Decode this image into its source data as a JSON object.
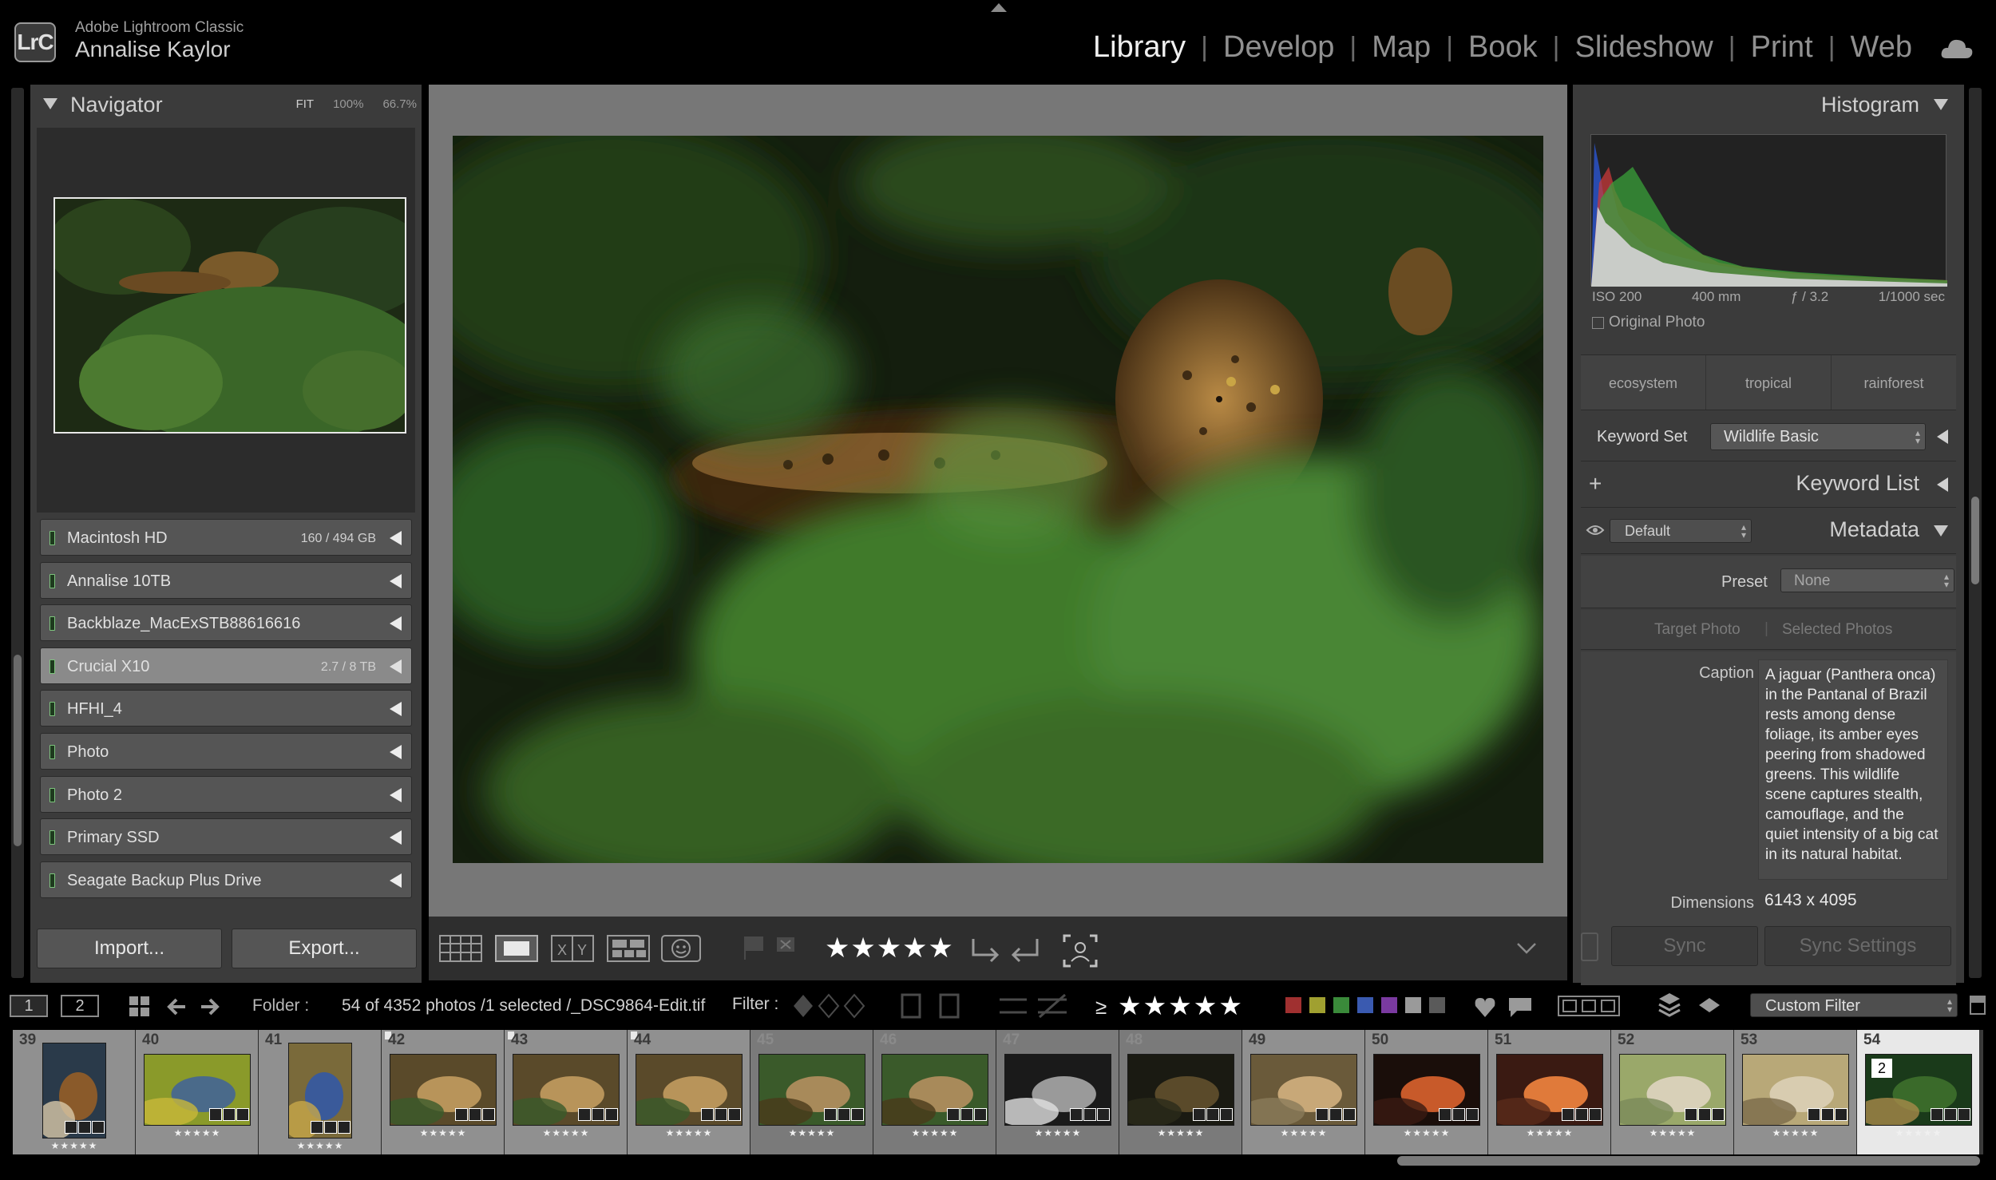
{
  "app": {
    "logo": "LrC",
    "name": "Adobe Lightroom Classic",
    "user": "Annalise Kaylor"
  },
  "modules": [
    {
      "label": "Library",
      "active": true
    },
    {
      "label": "Develop",
      "active": false
    },
    {
      "label": "Map",
      "active": false
    },
    {
      "label": "Book",
      "active": false
    },
    {
      "label": "Slideshow",
      "active": false
    },
    {
      "label": "Print",
      "active": false
    },
    {
      "label": "Web",
      "active": false
    }
  ],
  "module_separator": "|",
  "navigator": {
    "title": "Navigator",
    "zoom_fit": "FIT",
    "zoom_100": "100%",
    "zoom_custom": "66.7%"
  },
  "drives": [
    {
      "name": "Macintosh HD",
      "size": "160 / 494 GB",
      "selected": false
    },
    {
      "name": "Annalise 10TB",
      "size": "",
      "selected": false
    },
    {
      "name": "Backblaze_MacExSTB88616616",
      "size": "",
      "selected": false
    },
    {
      "name": "Crucial X10",
      "size": "2.7 / 8 TB",
      "selected": true
    },
    {
      "name": "HFHI_4",
      "size": "",
      "selected": false
    },
    {
      "name": "Photo",
      "size": "",
      "selected": false
    },
    {
      "name": "Photo 2",
      "size": "",
      "selected": false
    },
    {
      "name": "Primary SSD",
      "size": "",
      "selected": false
    },
    {
      "name": "Seagate Backup Plus Drive",
      "size": "",
      "selected": false
    }
  ],
  "buttons": {
    "import": "Import...",
    "export": "Export...",
    "sync": "Sync",
    "sync_settings": "Sync Settings"
  },
  "toolbar": {
    "stars": "★★★★★"
  },
  "histogram": {
    "title": "Histogram",
    "iso": "ISO 200",
    "focal": "400 mm",
    "aperture": "ƒ / 3.2",
    "shutter": "1/1000 sec",
    "original_photo": "Original Photo"
  },
  "keywords": {
    "suggestions": [
      "ecosystem",
      "tropical",
      "rainforest"
    ],
    "set_label": "Keyword Set",
    "set_value": "Wildlife Basic",
    "list_title": "Keyword List",
    "add_symbol": "+"
  },
  "metadata": {
    "title": "Metadata",
    "view": "Default",
    "preset_label": "Preset",
    "preset_value": "None",
    "target_photo": "Target Photo",
    "target_sep": "|",
    "selected_photos": "Selected Photos",
    "caption_label": "Caption",
    "caption": "A jaguar (Panthera onca) in the Pantanal of Brazil rests among dense foliage, its amber eyes peering from shadowed greens. This wildlife scene captures stealth, camouflage, and the quiet intensity of a big cat in its natural habitat.",
    "dimensions_label": "Dimensions",
    "dimensions": "6143 x 4095"
  },
  "filmstrip_bar": {
    "screen1": "1",
    "screen2": "2",
    "folder_label": "Folder :",
    "folder_info": "54 of 4352 photos /1 selected /_DSC9864-Edit.tif",
    "filter_label": "Filter :",
    "gte": "≥",
    "stars": "★★★★★",
    "custom_filter": "Custom Filter",
    "color_labels": [
      "#a03030",
      "#a0a030",
      "#3a8a3a",
      "#3a5ab0",
      "#7a3aa0",
      "#9a9a9a",
      "#5a5a5a"
    ]
  },
  "filmstrip": [
    {
      "num": "39",
      "stars": "★★★★★",
      "flag": false,
      "dim": false,
      "theme": "hawk"
    },
    {
      "num": "40",
      "stars": "★★★★★",
      "flag": false,
      "dim": false,
      "theme": "parrot"
    },
    {
      "num": "41",
      "stars": "★★★★★",
      "flag": false,
      "dim": false,
      "theme": "macaw"
    },
    {
      "num": "42",
      "stars": "★★★★★",
      "flag": true,
      "dim": false,
      "theme": "jaguar"
    },
    {
      "num": "43",
      "stars": "★★★★★",
      "flag": true,
      "dim": false,
      "theme": "jaguar"
    },
    {
      "num": "44",
      "stars": "★★★★★",
      "flag": true,
      "dim": false,
      "theme": "jaguar"
    },
    {
      "num": "45",
      "stars": "★★★★★",
      "flag": false,
      "dim": true,
      "theme": "jaguar2"
    },
    {
      "num": "46",
      "stars": "★★★★★",
      "flag": false,
      "dim": true,
      "theme": "jaguar2"
    },
    {
      "num": "47",
      "stars": "★★★★★",
      "flag": false,
      "dim": true,
      "theme": "bw"
    },
    {
      "num": "48",
      "stars": "★★★★★",
      "flag": false,
      "dim": true,
      "theme": "dark"
    },
    {
      "num": "49",
      "stars": "★★★★★",
      "flag": false,
      "dim": false,
      "theme": "road"
    },
    {
      "num": "50",
      "stars": "★★★★★",
      "flag": false,
      "dim": false,
      "theme": "sunset"
    },
    {
      "num": "51",
      "stars": "★★★★★",
      "flag": false,
      "dim": false,
      "theme": "sunset2"
    },
    {
      "num": "52",
      "stars": "★★★★★",
      "flag": false,
      "dim": false,
      "theme": "grass"
    },
    {
      "num": "53",
      "stars": "★★★★★",
      "flag": false,
      "dim": false,
      "theme": "grass2"
    },
    {
      "num": "54",
      "stars": "★★★★★",
      "flag": false,
      "dim": false,
      "theme": "jungle",
      "selected": true,
      "badge": "2"
    }
  ]
}
